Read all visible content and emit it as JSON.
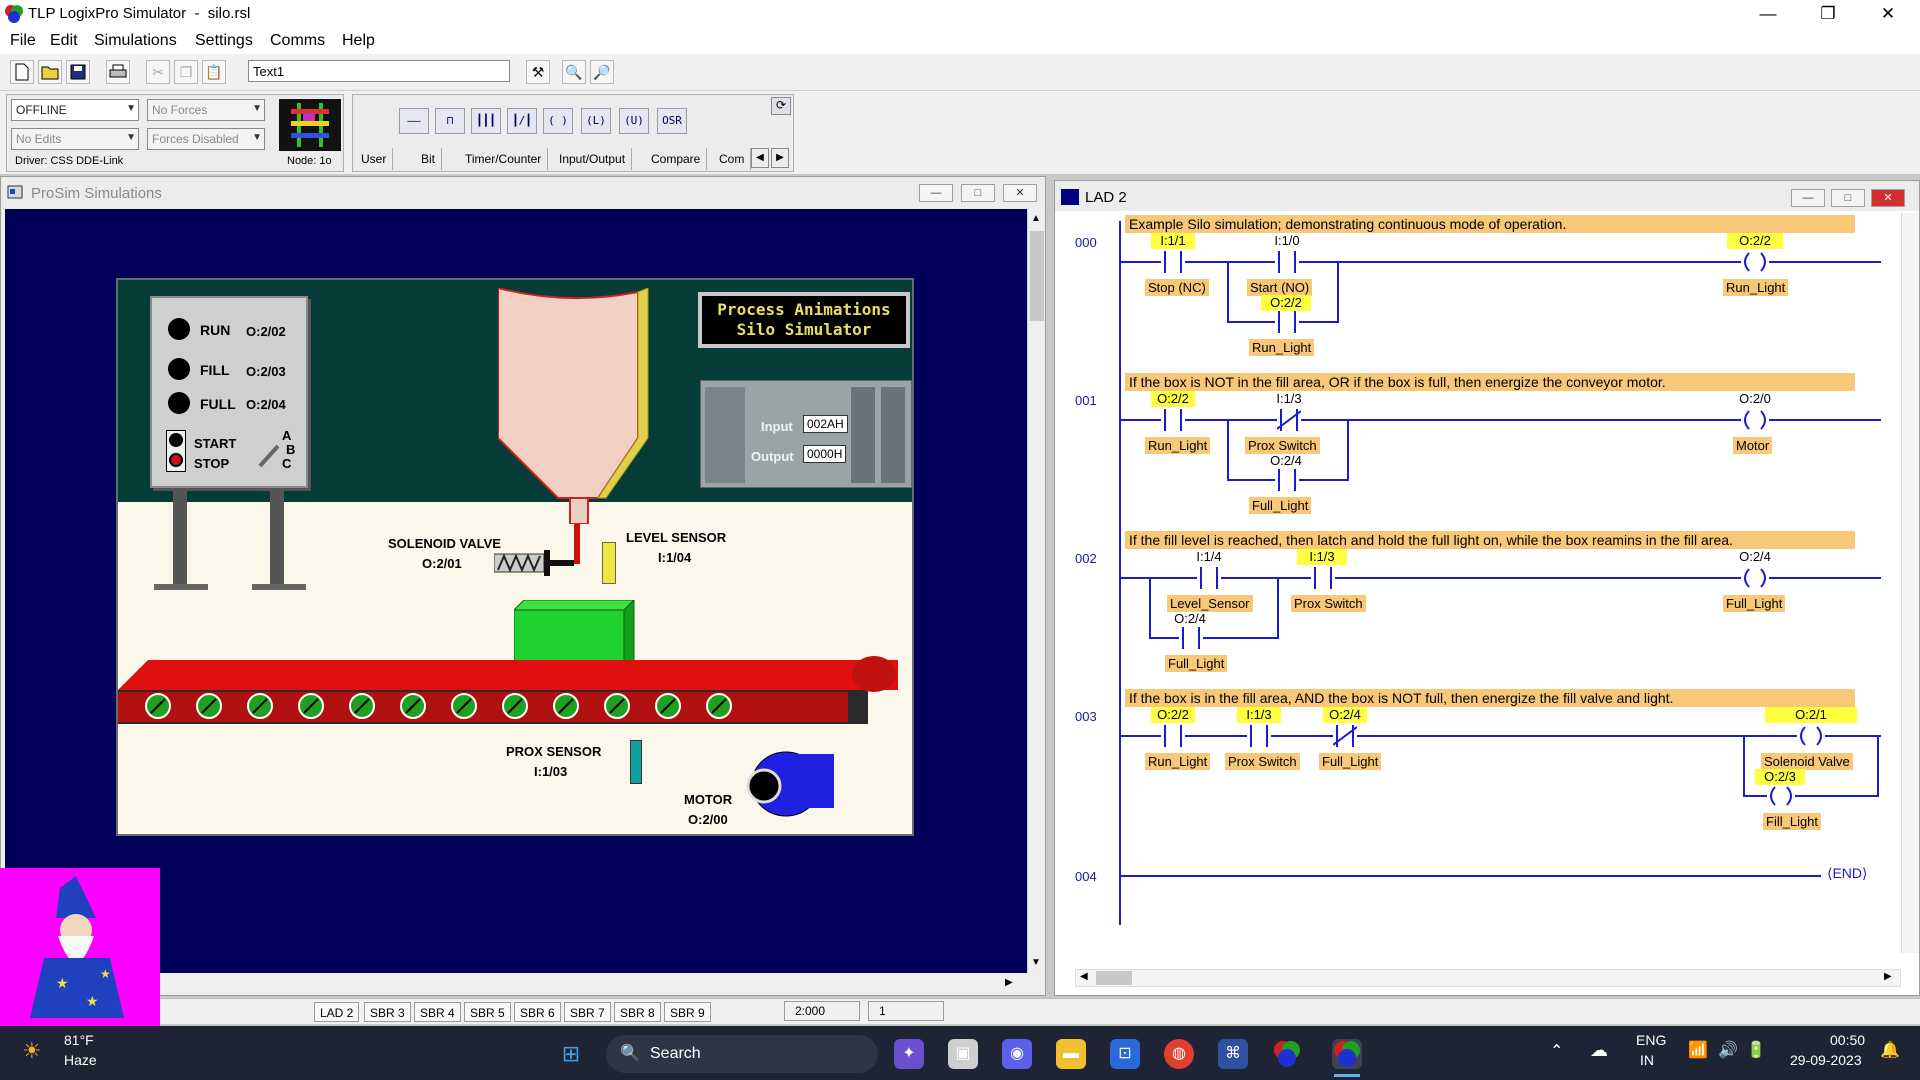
{
  "window": {
    "title": "TLP LogixPro Simulator  -  silo.rsl",
    "minimize": "—",
    "restore": "❐",
    "close": "✕"
  },
  "menu": [
    "File",
    "Edit",
    "Simulations",
    "Settings",
    "Comms",
    "Help"
  ],
  "toolbar": {
    "text_field_value": "Text1"
  },
  "status": {
    "mode": "OFFLINE",
    "forces": "No Forces",
    "edits": "No Edits",
    "forces_state": "Forces Disabled",
    "driver": "Driver:  CSS DDE-Link",
    "node": "Node: 1o"
  },
  "instructions": {
    "buttons": [
      "——",
      "⊓",
      "┃┃┃",
      "┃/┃",
      "( )",
      "(L)",
      "(U)",
      "OSR"
    ],
    "tabs": [
      "User",
      "Bit",
      "Timer/Counter",
      "Input/Output",
      "Compare",
      "Com"
    ]
  },
  "prosim": {
    "title": "ProSim Simulations",
    "buttons": {
      "min": "—",
      "max": "□",
      "close": "✕"
    },
    "panel": {
      "run_label": "RUN",
      "run_addr": "O:2/02",
      "fill_label": "FILL",
      "fill_addr": "O:2/03",
      "full_label": "FULL",
      "full_addr": "O:2/04",
      "start_label": "START",
      "stop_label": "STOP",
      "abc": [
        "A",
        "B",
        "C"
      ]
    },
    "banner_line1": "Process Animations",
    "banner_line2": "Silo Simulator",
    "plc_input_label": "Input",
    "plc_input_value": "002AH",
    "plc_output_label": "Output",
    "plc_output_value": "0000H",
    "solenoid_label": "SOLENOID VALVE",
    "solenoid_addr": "O:2/01",
    "level_label": "LEVEL SENSOR",
    "level_addr": "I:1/04",
    "prox_label": "PROX SENSOR",
    "prox_addr": "I:1/03",
    "motor_label": "MOTOR",
    "motor_addr": "O:2/00"
  },
  "lad": {
    "title": "LAD 2",
    "rungs": [
      {
        "no": "000",
        "comment": "Example Silo simulation;  demonstrating continuous mode of operation.",
        "elements": [
          {
            "addr": "I:1/1",
            "desc": "Stop (NC)",
            "highlight": true
          },
          {
            "addr": "I:1/0",
            "desc": "Start (NO)",
            "highlight": false
          },
          {
            "addr": "O:2/2",
            "desc": "Run_Light",
            "highlight": true
          },
          {
            "addr": "O:2/2",
            "desc": "Run_Light",
            "highlight": true
          }
        ]
      },
      {
        "no": "001",
        "comment": "If the box is NOT in the fill area, OR if  the box is full, then energize the conveyor motor.",
        "elements": [
          {
            "addr": "O:2/2",
            "desc": "Run_Light",
            "highlight": true
          },
          {
            "addr": "I:1/3",
            "desc": "Prox Switch",
            "highlight": false
          },
          {
            "addr": "O:2/4",
            "desc": "Full_Light",
            "highlight": false
          },
          {
            "addr": "O:2/0",
            "desc": "Motor",
            "highlight": false
          }
        ]
      },
      {
        "no": "002",
        "comment": "If the fill level is reached, then latch and hold the full light on, while the box reamins in the fill area.",
        "elements": [
          {
            "addr": "I:1/4",
            "desc": "Level_Sensor",
            "highlight": false
          },
          {
            "addr": "O:2/4",
            "desc": "Full_Light",
            "highlight": false
          },
          {
            "addr": "I:1/3",
            "desc": "Prox Switch",
            "highlight": true
          },
          {
            "addr": "O:2/4",
            "desc": "Full_Light",
            "highlight": false
          }
        ]
      },
      {
        "no": "003",
        "comment": "If the box is in the fill area, AND the box is NOT full, then energize the fill valve and light.",
        "elements": [
          {
            "addr": "O:2/2",
            "desc": "Run_Light",
            "highlight": true
          },
          {
            "addr": "I:1/3",
            "desc": "Prox Switch",
            "highlight": true
          },
          {
            "addr": "O:2/4",
            "desc": "Full_Light",
            "highlight": true
          },
          {
            "addr": "O:2/1",
            "desc": "Solenoid Valve",
            "highlight": true
          },
          {
            "addr": "O:2/3",
            "desc": "Fill_Light",
            "highlight": true
          }
        ]
      },
      {
        "no": "004",
        "end_label": "END"
      }
    ]
  },
  "tabs": [
    "LAD 2",
    "SBR 3",
    "SBR 4",
    "SBR 5",
    "SBR 6",
    "SBR 7",
    "SBR 8",
    "SBR 9"
  ],
  "status_cells": [
    "2:000",
    "1"
  ],
  "taskbar": {
    "weather_temp": "81°F",
    "weather_desc": "Haze",
    "search": "Search",
    "lang1": "ENG",
    "lang2": "IN",
    "time": "00:50",
    "date": "29-09-2023"
  }
}
